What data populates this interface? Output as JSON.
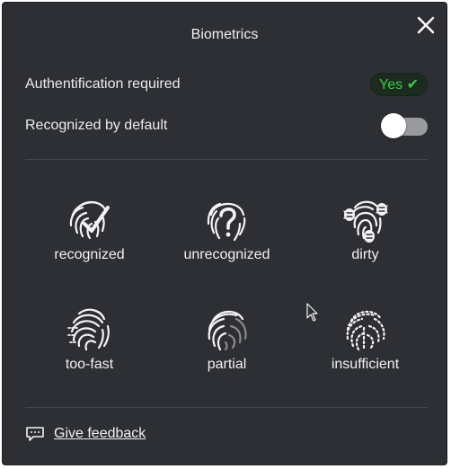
{
  "dialog": {
    "title": "Biometrics"
  },
  "settings": {
    "auth_required": {
      "label": "Authentification required",
      "value": "Yes ✔"
    },
    "recognized_default": {
      "label": "Recognized by default",
      "state": "off"
    }
  },
  "states": [
    {
      "label": "recognized",
      "icon": "fingerprint-check-icon"
    },
    {
      "label": "unrecognized",
      "icon": "fingerprint-question-icon"
    },
    {
      "label": "dirty",
      "icon": "fingerprint-bugs-icon"
    },
    {
      "label": "too-fast",
      "icon": "fingerprint-smeared-icon"
    },
    {
      "label": "partial",
      "icon": "fingerprint-partial-icon"
    },
    {
      "label": "insufficient",
      "icon": "fingerprint-dotted-icon"
    }
  ],
  "footer": {
    "feedback_label": "Give feedback"
  },
  "colors": {
    "panel_bg": "#2d2f35",
    "accent_green": "#2fd04c",
    "toggle_track": "#9a9b9f"
  }
}
